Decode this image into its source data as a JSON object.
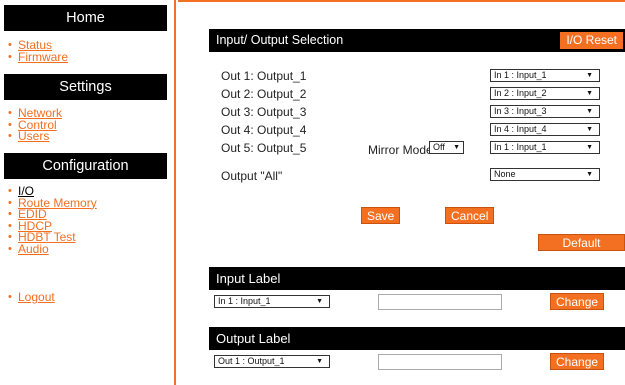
{
  "sidebar": {
    "home_header": "Home",
    "home_items": [
      {
        "label": "Status"
      },
      {
        "label": "Firmware"
      }
    ],
    "settings_header": "Settings",
    "settings_items": [
      {
        "label": "Network"
      },
      {
        "label": "Control"
      },
      {
        "label": "Users"
      }
    ],
    "config_header": "Configuration",
    "config_items": [
      {
        "label": "I/O"
      },
      {
        "label": "Route Memory"
      },
      {
        "label": "EDID"
      },
      {
        "label": "HDCP"
      },
      {
        "label": "HDBT Test"
      },
      {
        "label": "Audio"
      }
    ],
    "logout": "Logout"
  },
  "io_selection": {
    "title": "Input/ Output Selection",
    "reset_label": "I/O Reset",
    "outputs": [
      {
        "label": "Out 1: Output_1",
        "selected": "In 1 : Input_1"
      },
      {
        "label": "Out 2: Output_2",
        "selected": "In 2 : Input_2"
      },
      {
        "label": "Out 3: Output_3",
        "selected": "In 3 : Input_3"
      },
      {
        "label": "Out 4: Output_4",
        "selected": "In 4 : Input_4"
      },
      {
        "label": "Out 5: Output_5",
        "selected": "In 1 : Input_1"
      }
    ],
    "mirror_label": "Mirror Mode",
    "mirror_value": "Off",
    "all_label": "Output \"All\"",
    "all_value": "None",
    "save_label": "Save",
    "cancel_label": "Cancel",
    "default_label": "Default Routing"
  },
  "input_label": {
    "title": "Input Label",
    "selected": "In 1 : Input_1",
    "value": "",
    "change_label": "Change"
  },
  "output_label": {
    "title": "Output Label",
    "selected": "Out 1 : Output_1",
    "value": "",
    "change_label": "Change"
  },
  "colors": {
    "accent": "#f36f21",
    "header_bg": "#000000"
  }
}
